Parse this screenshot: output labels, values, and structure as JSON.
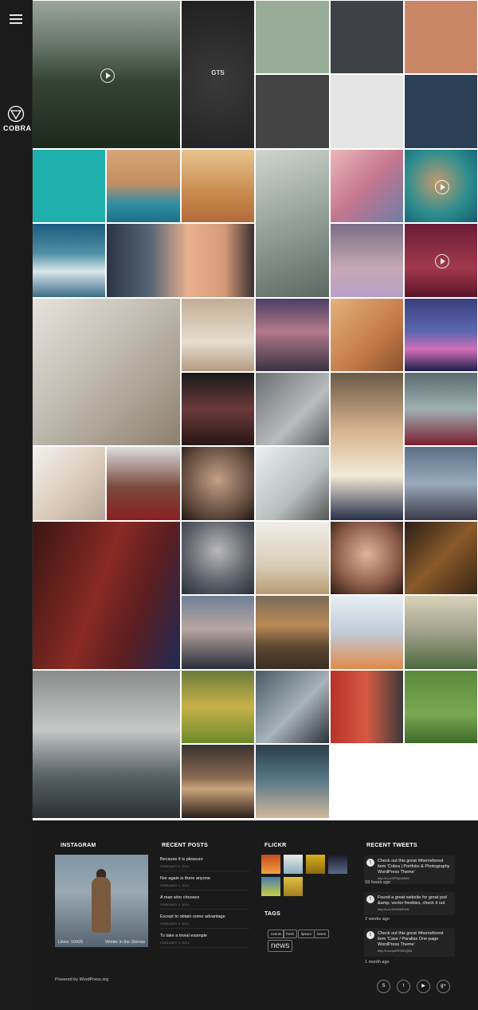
{
  "sidebar": {
    "menu_icon": "hamburger-icon",
    "logo_text": "COBRA"
  },
  "grid": {
    "tiles": [
      {
        "name": "landscape-video-tile",
        "bg": "linear-gradient(#9aa69a 0%,#6a7a6c 28%,#344432 55%,#1c2a1c 100%)",
        "play": true
      },
      {
        "name": "gts-tshirt-tile",
        "bg": "radial-gradient(circle at 50% 55%,#3a3a3a,#202020)",
        "label": "GTS"
      },
      {
        "name": "tablet-mockup-tile",
        "bg": "#98ac98"
      },
      {
        "name": "shopping-bag-tile",
        "bg": "#3e4146"
      },
      {
        "name": "tablet-orange-tile",
        "bg": "#c98768"
      },
      {
        "name": "phone-landscape-tile",
        "bg": "#444"
      },
      {
        "name": "phone-black-tile",
        "bg": "#e4e4e4"
      },
      {
        "name": "ipad-navy-tile",
        "bg": "#2c4055"
      },
      {
        "name": "coffee-cup-tile",
        "bg": "#1fb0ae"
      },
      {
        "name": "arches-pool-tile",
        "bg": "linear-gradient(#d7a57a,#c78e60 45%,#2e8ea5 75%,#1e6f86)"
      },
      {
        "name": "woman-sunset-tile",
        "bg": "linear-gradient(#e8c48e,#c88a4e 60%,#b26a3a)"
      },
      {
        "name": "sneakers-tile",
        "bg": "linear-gradient(160deg,#cfd5cf,#8d9b94 55%,#5c6962)"
      },
      {
        "name": "grass-pink-tile",
        "bg": "linear-gradient(135deg,#ecb7b8,#c4768f 50%,#6c7ea6)"
      },
      {
        "name": "aerial-coast-tile",
        "bg": "radial-gradient(circle at 45% 45%,#c29a6d,#2f8e8f 55%,#145f73)",
        "play": true
      },
      {
        "name": "mountains-tile",
        "bg": "linear-gradient(#1c5b7e,#4f8fa6 40%,#d9e6ec 65%,#3e6e86)"
      },
      {
        "name": "redhead-closeup-tile",
        "bg": "linear-gradient(90deg,#2a3545,#586676 30%,#e8b08e 55%,#d59a7a 80%,#3a3030)"
      },
      {
        "name": "woman-lilac-tile",
        "bg": "linear-gradient(#7b6e85,#c6a8b4 60%,#b9a0c8)"
      },
      {
        "name": "woman-purple-video-tile",
        "bg": "linear-gradient(#6b1c36,#a13a4c 60%,#5a1428)",
        "play": true
      },
      {
        "name": "woman-black-dress-tile",
        "bg": "linear-gradient(135deg,#e6e3dc,#bdb6ab 50%,#8e7f6e)"
      },
      {
        "name": "woman-bed-tile",
        "bg": "linear-gradient(#c2ad94,#e6ddd0 60%,#b59a80)"
      },
      {
        "name": "pier-sunset-tile",
        "bg": "linear-gradient(#4c3d65,#b27a8a 45%,#3a3344)"
      },
      {
        "name": "blonde-woman-tile",
        "bg": "linear-gradient(135deg,#e2b27a,#c47a48 60%,#8a5230)"
      },
      {
        "name": "city-night-tile",
        "bg": "linear-gradient(#3b3f7c,#5b66b0 45%,#d16fb8 70%,#1c1f4a)"
      },
      {
        "name": "woman-chair-tile",
        "bg": "linear-gradient(#1a1a1a,#6a3a3a 50%,#2a1616)"
      },
      {
        "name": "woman-red-heels-tile",
        "bg": "linear-gradient(135deg,#6a6e72,#b9bcbd 60%,#595c5f)"
      },
      {
        "name": "woman-lace-top-tile",
        "bg": "linear-gradient(#6a5a46,#d8b590 40%,#f2e9d6 70%,#27304a)"
      },
      {
        "name": "yoga-woman-tile",
        "bg": "linear-gradient(#5a6a6e,#9fb0b3 50%,#7b2030)"
      },
      {
        "name": "woman-laptop-tile",
        "bg": "linear-gradient(135deg,#f2f2f2,#d9c7b4 60%,#b2a59a)"
      },
      {
        "name": "woman-red-dress-tile",
        "bg": "linear-gradient(#dcdcdc,#7a4a3e 55%,#8a1f20)"
      },
      {
        "name": "eyes-closeup-tile",
        "bg": "radial-gradient(circle at 50% 45%,#c5a088,#5a4438 70%,#1a1414)"
      },
      {
        "name": "woman-lounge-chair-tile",
        "bg": "linear-gradient(135deg,#ecefef,#b7bdbd 60%,#555)"
      },
      {
        "name": "woman-sidewalk-tile",
        "bg": "linear-gradient(#5a6f86,#9aaabc 50%,#3a3a48)"
      },
      {
        "name": "redhead-room-tile",
        "bg": "linear-gradient(110deg,#3a1614,#8a2a24 45%,#5a1e20 70%,#1f2a55)"
      },
      {
        "name": "woman-storm-tile",
        "bg": "radial-gradient(circle at 50% 40%,#b9b9b9,#5a5e66 60%,#2a2e38)"
      },
      {
        "name": "woman-basket-tile",
        "bg": "linear-gradient(#f0eee8,#d8cdb8 60%,#b89a72)"
      },
      {
        "name": "woman-teal-eyes-tile",
        "bg": "radial-gradient(circle at 50% 45%,#e0b49c,#8a5a46 60%,#2a1a16)"
      },
      {
        "name": "city-street-night-tile",
        "bg": "linear-gradient(135deg,#2a1e18,#8a5a2a 50%,#3a2616)"
      },
      {
        "name": "stormy-sky-tile",
        "bg": "linear-gradient(#6e7f96,#b8a6a2 45%,#2a2e38)"
      },
      {
        "name": "river-autumn-tile",
        "bg": "linear-gradient(#7a6a58,#b98a56 40%,#5a4632 70%,#3a2e24)"
      },
      {
        "name": "smiling-girl-tile",
        "bg": "linear-gradient(#e9eef4,#c0cbd8 50%,#e08a4a)"
      },
      {
        "name": "couple-bench-tile",
        "bg": "linear-gradient(#d9d2b8,#9fa08a 50%,#4e6a3e)"
      },
      {
        "name": "building-aerial-tile",
        "bg": "linear-gradient(#8a8c8c,#c6c8c8 40%,#5a6668 70%,#2a3034)"
      },
      {
        "name": "boy-running-tile",
        "bg": "linear-gradient(#6a7a3a,#c8b24a 50%,#6a8a2a)"
      },
      {
        "name": "man-balcony-tile",
        "bg": "linear-gradient(135deg,#4a5a66,#a8b4ba 55%,#2a3038)"
      },
      {
        "name": "box-heads-tile",
        "bg": "linear-gradient(90deg,#b8322a,#d65a44 50%,#3a3a3a)"
      },
      {
        "name": "box-heads-grass-tile",
        "bg": "linear-gradient(#5a8a3a,#7aa852 60%,#3e6a2a)"
      },
      {
        "name": "pier-dusk-tile",
        "bg": "linear-gradient(#3a3230,#8a6a52 45%,#c9a47a 60%,#2a1e18)"
      },
      {
        "name": "woman-denim-tile",
        "bg": "linear-gradient(#2a3e4a,#5a7a8a 50%,#d0b89a)"
      }
    ]
  },
  "footer": {
    "instagram": {
      "title": "INSTAGRAM",
      "likes": "Likes: 10425",
      "caption": "Winter in the Sierras"
    },
    "recent_posts": {
      "title": "RECENT POSTS",
      "items": [
        {
          "title": "Because it is pleasure",
          "date": "FEBRUARY 9, 2014"
        },
        {
          "title": "Nor again is there anyone",
          "date": "FEBRUARY 9, 2014"
        },
        {
          "title": "A man who chooses",
          "date": "FEBRUARY 9, 2014"
        },
        {
          "title": "Except to obtain some advantage",
          "date": "FEBRUARY 9, 2014"
        },
        {
          "title": "To take a trivial example",
          "date": "FEBRUARY 9, 2014"
        }
      ]
    },
    "flickr": {
      "title": "FLICKR",
      "thumbs": [
        {
          "color": "linear-gradient(#c84a1e,#f0a040)"
        },
        {
          "color": "linear-gradient(#e8e8e8,#8ab0c0)"
        },
        {
          "color": "linear-gradient(#d8b020,#8a6a10)"
        },
        {
          "color": "linear-gradient(#1a1a2a,#5a6a8a)"
        },
        {
          "color": "linear-gradient(#4a7ab0,#c8d040)"
        },
        {
          "color": "linear-gradient(#e0c040,#a08020)"
        }
      ]
    },
    "tags": {
      "title": "TAGS",
      "items": [
        "events",
        "fresh",
        "lipsum",
        "lorem",
        "news"
      ]
    },
    "recent_tweets": {
      "title": "RECENT TWEETS",
      "items": [
        {
          "text": "Check out this great #themeforest item 'Cobra | Portfolio & Photography WordPress Theme'",
          "link": "http://t.co/3FRqUJ8D5",
          "time": "19 hours ago"
        },
        {
          "text": "Found a great website for great psd &amp; vector freebies, check it out",
          "link": "http://t.co/1E3HkPUHf",
          "time": "2 weeks ago"
        },
        {
          "text": "Check out this great #themeforest item 'Case / Parallax One-page WordPress Theme'",
          "link": "http://t.co/pvKR3SOQkD",
          "time": "1 month ago"
        }
      ]
    },
    "powered_by": "Powered by WordPress.org",
    "social": [
      {
        "icon": "skype-icon",
        "glyph": "S"
      },
      {
        "icon": "twitter-icon",
        "glyph": "t"
      },
      {
        "icon": "youtube-icon",
        "glyph": "▶"
      },
      {
        "icon": "google-plus-icon",
        "glyph": "g+"
      }
    ]
  }
}
